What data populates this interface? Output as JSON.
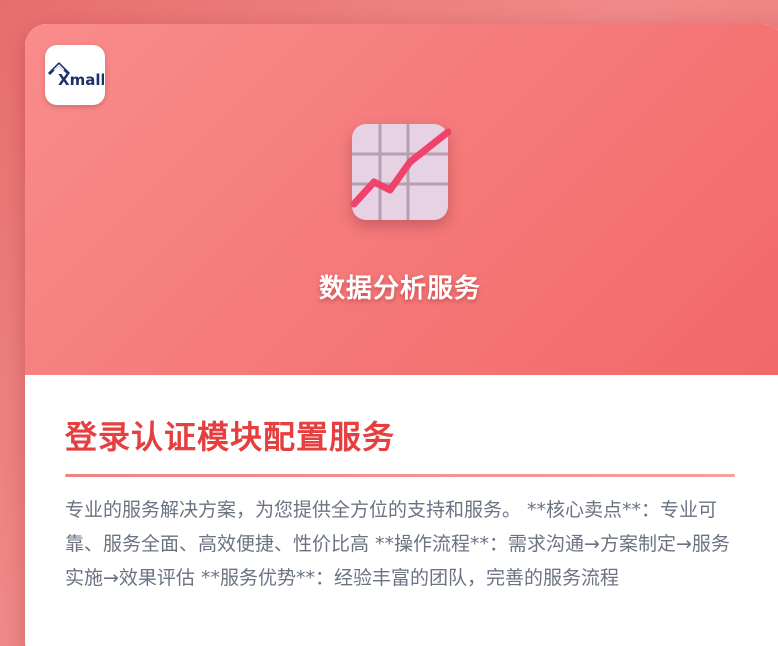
{
  "brand": {
    "logo_text": "Xmall",
    "accent_color": "#e53f3f",
    "hero_color": "#f57a7a"
  },
  "hero": {
    "title": "数据分析服务",
    "icon": "chart-trend-icon"
  },
  "service": {
    "title": "登录认证模块配置服务",
    "description": "专业的服务解决方案，为您提供全方位的支持和服务。 **核心卖点**：专业可靠、服务全面、高效便捷、性价比高 **操作流程**：需求沟通→方案制定→服务实施→效果评估 **服务优势**：经验丰富的团队，完善的服务流程"
  }
}
